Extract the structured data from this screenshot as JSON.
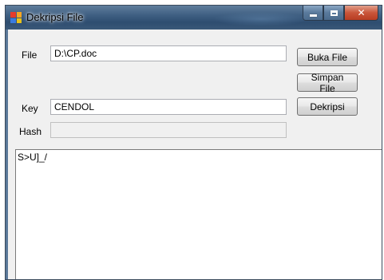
{
  "window": {
    "title": "Dekripsi File"
  },
  "form": {
    "file_label": "File",
    "file_value": "D:\\CP.doc",
    "key_label": "Key",
    "key_value": "CENDOL",
    "hash_label": "Hash",
    "hash_value": ""
  },
  "buttons": {
    "open_label": "Buka File",
    "save_label": "Simpan File",
    "decrypt_label": "Dekripsi"
  },
  "output": {
    "text": "S>U]_/"
  },
  "colors": {
    "titlebar": "#3f5f82",
    "close_button": "#c9553a",
    "window_bg": "#f0f0f0"
  }
}
